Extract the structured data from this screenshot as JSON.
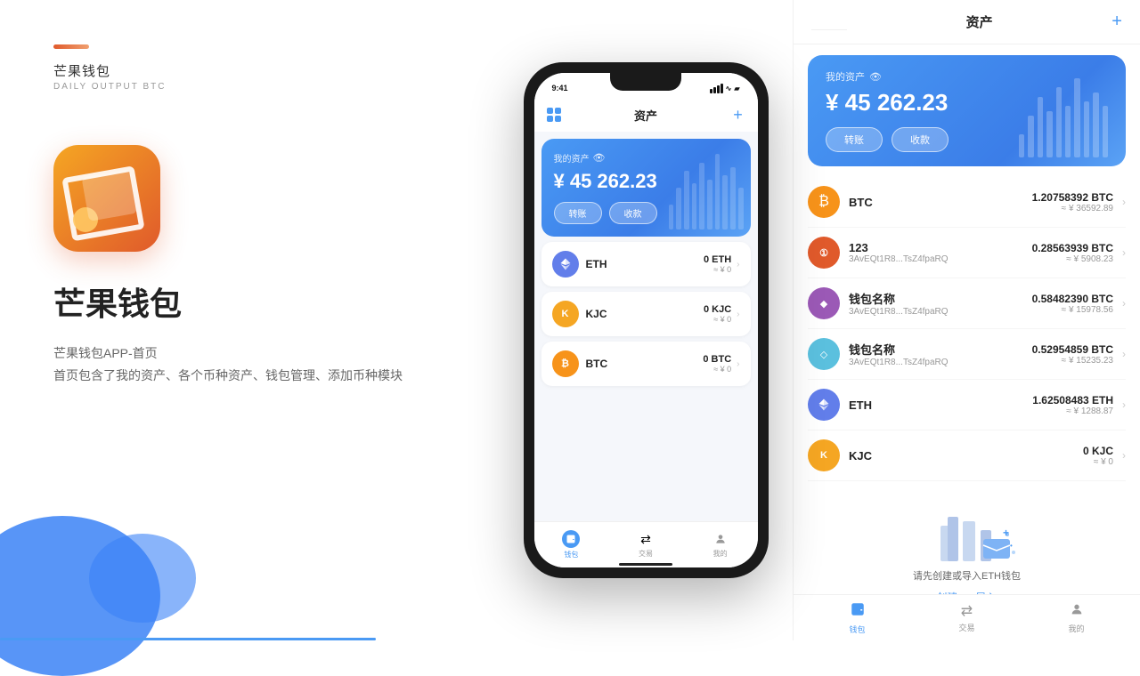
{
  "app": {
    "name": "芒果钱包",
    "subtitle": "DAILY OUTPUT BTC",
    "tagline": "芒果钱包",
    "description1": "芒果钱包APP-首页",
    "description2": "首页包含了我的资产、各个币种资产、钱包管理、添加币种模块"
  },
  "phone": {
    "time": "9:41",
    "header_title": "资产",
    "asset_label": "我的资产",
    "asset_amount": "¥ 45 262.23",
    "transfer_btn": "转账",
    "receive_btn": "收款",
    "coins": [
      {
        "name": "ETH",
        "type": "eth",
        "amount": "0 ETH",
        "cny": "≈ ¥ 0"
      },
      {
        "name": "KJC",
        "type": "kjc",
        "amount": "0 KJC",
        "cny": "≈ ¥ 0"
      },
      {
        "name": "BTC",
        "type": "btc",
        "amount": "0 BTC",
        "cny": "≈ ¥ 0"
      }
    ],
    "nav": [
      {
        "label": "钱包",
        "active": true
      },
      {
        "label": "交易",
        "active": false
      },
      {
        "label": "我的",
        "active": false
      }
    ]
  },
  "right": {
    "header_title": "资产",
    "asset_label": "我的资产",
    "asset_amount": "¥ 45 262.23",
    "transfer_btn": "转账",
    "receive_btn": "收款",
    "coins": [
      {
        "name": "BTC",
        "type": "btc",
        "addr": "",
        "amount": "1.20758392 BTC",
        "cny": "≈ ¥ 36592.89"
      },
      {
        "name": "123",
        "type": "custom1",
        "addr": "3AvEQt1R8...TsZ4fpaRQ",
        "amount": "0.28563939 BTC",
        "cny": "≈ ¥ 5908.23"
      },
      {
        "name": "钱包名称",
        "type": "purple",
        "addr": "3AvEQt1R8...TsZ4fpaRQ",
        "amount": "0.58482390 BTC",
        "cny": "≈ ¥ 15978.56"
      },
      {
        "name": "钱包名称",
        "type": "diamond",
        "addr": "3AvEQt1R8...TsZ4fpaRQ",
        "amount": "0.52954859 BTC",
        "cny": "≈ ¥ 15235.23"
      },
      {
        "name": "ETH",
        "type": "eth",
        "addr": "",
        "amount": "1.62508483 ETH",
        "cny": "≈ ¥ 1288.87"
      },
      {
        "name": "KJC",
        "type": "kjc",
        "addr": "",
        "amount": "0 KJC",
        "cny": "≈ ¥ 0"
      }
    ],
    "eth_prompt": "请先创建或导入ETH钱包",
    "eth_create": "创建",
    "eth_import": "导入",
    "nav": [
      {
        "label": "钱包",
        "active": true
      },
      {
        "label": "交易",
        "active": false
      },
      {
        "label": "我的",
        "active": false
      }
    ]
  },
  "bars": [
    30,
    50,
    70,
    55,
    80,
    60,
    90,
    65,
    75,
    50
  ],
  "right_bars": [
    25,
    45,
    65,
    50,
    75,
    55,
    85,
    60,
    70,
    55
  ]
}
